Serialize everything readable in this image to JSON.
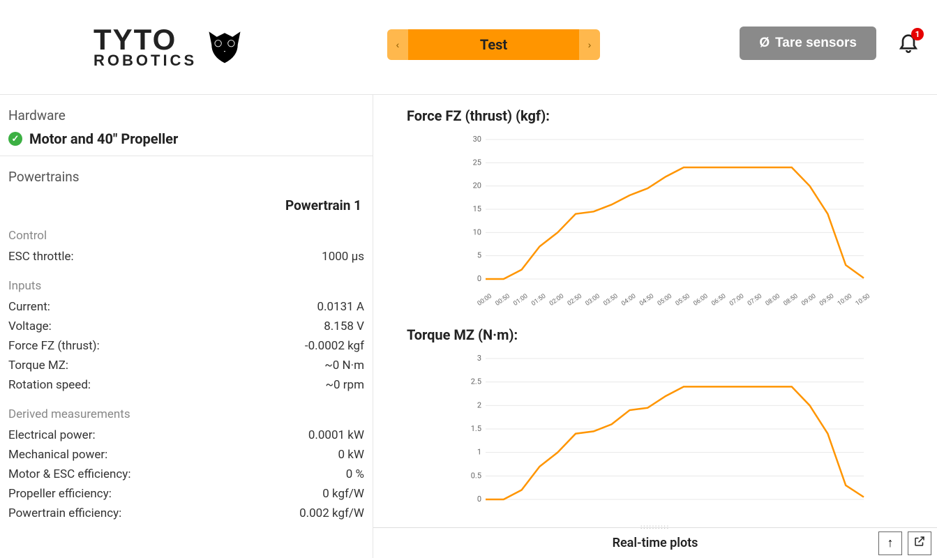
{
  "brand": {
    "top": "TYTO",
    "bottom": "ROBOTICS"
  },
  "header": {
    "carousel_label": "Test",
    "tare_label": "Tare sensors",
    "notification_count": "1"
  },
  "sidebar": {
    "hardware_title": "Hardware",
    "hardware_name": "Motor and 40\" Propeller",
    "powertrains_title": "Powertrains",
    "powertrain_name": "Powertrain 1",
    "control_title": "Control",
    "control_rows": [
      {
        "k": "ESC throttle:",
        "v": "1000 µs"
      }
    ],
    "inputs_title": "Inputs",
    "input_rows": [
      {
        "k": "Current:",
        "v": "0.0131 A"
      },
      {
        "k": "Voltage:",
        "v": "8.158 V"
      },
      {
        "k": "Force FZ (thrust):",
        "v": "-0.0002 kgf"
      },
      {
        "k": "Torque MZ:",
        "v": "~0 N·m"
      },
      {
        "k": "Rotation speed:",
        "v": "~0 rpm"
      }
    ],
    "derived_title": "Derived measurements",
    "derived_rows": [
      {
        "k": "Electrical power:",
        "v": "0.0001 kW"
      },
      {
        "k": "Mechanical power:",
        "v": "0 kW"
      },
      {
        "k": "Motor & ESC efficiency:",
        "v": "0 %"
      },
      {
        "k": "Propeller efficiency:",
        "v": "0 kgf/W"
      },
      {
        "k": "Powertrain efficiency:",
        "v": "0.002 kgf/W"
      }
    ]
  },
  "footer": {
    "label": "Real-time plots"
  },
  "chart_data": [
    {
      "type": "line",
      "title": "Force FZ (thrust) (kgf):",
      "xlabel": "",
      "ylabel": "",
      "ylim": [
        0,
        30
      ],
      "yticks": [
        0,
        5,
        10,
        15,
        20,
        25,
        30
      ],
      "categories": [
        "00:00",
        "00:50",
        "01:00",
        "01:50",
        "02:00",
        "02:50",
        "03:00",
        "03:50",
        "04:00",
        "04:50",
        "05:00",
        "05:50",
        "06:00",
        "06:50",
        "07:00",
        "07:50",
        "08:00",
        "08:50",
        "09:00",
        "09:50",
        "10:00",
        "10:50"
      ],
      "values": [
        0,
        0,
        2,
        7,
        10,
        14,
        14.5,
        16,
        18,
        19.5,
        22,
        24,
        24,
        24,
        24,
        24,
        24,
        24,
        20,
        14,
        3,
        0.2
      ]
    },
    {
      "type": "line",
      "title": "Torque MZ (N·m):",
      "xlabel": "",
      "ylabel": "",
      "ylim": [
        0,
        3
      ],
      "yticks": [
        0,
        0.5,
        1,
        1.5,
        2,
        2.5,
        3
      ],
      "categories": [
        "00:00",
        "00:50",
        "01:00",
        "01:50",
        "02:00",
        "02:50",
        "03:00",
        "03:50",
        "04:00",
        "04:50",
        "05:00",
        "05:50",
        "06:00",
        "06:50",
        "07:00",
        "07:50",
        "08:00",
        "08:50",
        "09:00",
        "09:50",
        "10:00",
        "10:50"
      ],
      "values": [
        0,
        0,
        0.2,
        0.7,
        1.0,
        1.4,
        1.45,
        1.6,
        1.9,
        1.95,
        2.2,
        2.4,
        2.4,
        2.4,
        2.4,
        2.4,
        2.4,
        2.4,
        2.0,
        1.4,
        0.3,
        0.05
      ]
    }
  ]
}
